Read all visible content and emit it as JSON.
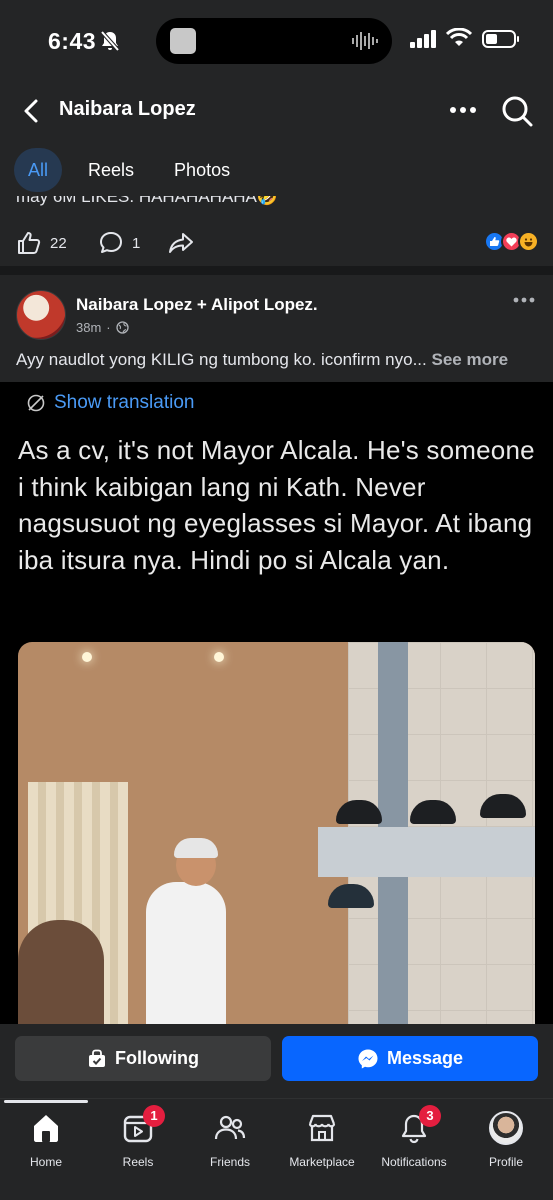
{
  "status_bar": {
    "time": "6:43"
  },
  "header": {
    "title": "Naibara Lopez"
  },
  "tabs": [
    {
      "label": "All",
      "active": true
    },
    {
      "label": "Reels",
      "active": false
    },
    {
      "label": "Photos",
      "active": false
    }
  ],
  "previous_post": {
    "text_partial": "may 6M LIKES. HAHAHAHAHA🤣",
    "like_count": "22",
    "comment_count": "1"
  },
  "post": {
    "author": "Naibara Lopez + Alipot Lopez.",
    "time": "38m",
    "separator": "·",
    "caption": "Ayy naudlot yong KILIG ng tumbong ko. iconfirm nyo...",
    "see_more": "See more",
    "shared_image": {
      "show_translation": "Show translation",
      "quote": "As a cv, it's not Mayor Alcala. He's someone i think kaibigan lang ni Kath. Never nagsusuot ng eyeglasses si Mayor. At ibang iba itsura nya. Hindi po si Alcala yan."
    }
  },
  "actions": {
    "following_label": "Following",
    "message_label": "Message"
  },
  "nav": [
    {
      "label": "Home",
      "badge": ""
    },
    {
      "label": "Reels",
      "badge": "1"
    },
    {
      "label": "Friends",
      "badge": ""
    },
    {
      "label": "Marketplace",
      "badge": ""
    },
    {
      "label": "Notifications",
      "badge": "3"
    },
    {
      "label": "Profile",
      "badge": ""
    }
  ],
  "colors": {
    "accent": "#0866ff",
    "link": "#4a9af5",
    "badge": "#e41e3f",
    "background": "#242526"
  }
}
